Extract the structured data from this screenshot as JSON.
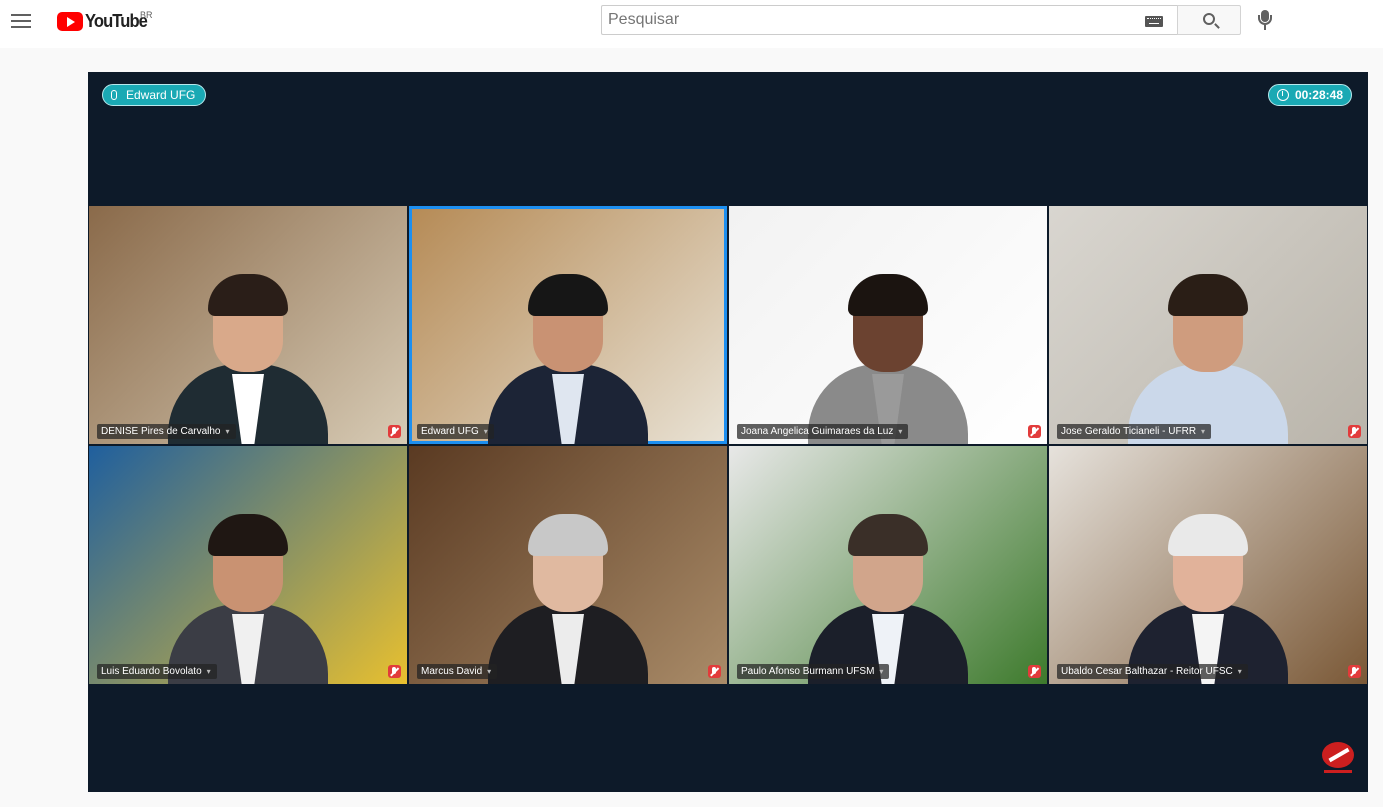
{
  "header": {
    "logo_text": "YouTube",
    "region": "BR",
    "search_placeholder": "Pesquisar"
  },
  "call": {
    "active_speaker": "Edward UFG",
    "elapsed": "00:28:48"
  },
  "participants": [
    {
      "name": "DENISE Pires de Carvalho",
      "muted": true,
      "background": "bookshelf",
      "bg": "#8a6a4a",
      "bg2": "#d7cbb5",
      "skin": "#d9a98a",
      "hair": "#2a1e18",
      "outfit": "#1f2c33",
      "shirt": "#ffffff"
    },
    {
      "name": "Edward UFG",
      "muted": false,
      "background": "office wall",
      "bg": "#b58a55",
      "bg2": "#e9e3d6",
      "skin": "#c99273",
      "hair": "#161616",
      "outfit": "#1c2436",
      "shirt": "#dfe6f0"
    },
    {
      "name": "Joana Angelica Guimaraes da Luz",
      "muted": true,
      "background": "white wall",
      "bg": "#f2f2f2",
      "bg2": "#ffffff",
      "skin": "#6b4230",
      "hair": "#1b1410",
      "outfit": "#8a8a8a",
      "shirt": "#9a9a9a"
    },
    {
      "name": "Jose Geraldo Ticianeli - UFRR",
      "muted": true,
      "background": "office with flag",
      "bg": "#d9d6d0",
      "bg2": "#b9b4aa",
      "skin": "#cf9c7e",
      "hair": "#2a1e16",
      "outfit": "#cbd8ea",
      "shirt": "#cbd8ea"
    },
    {
      "name": "Luis Eduardo Bovolato",
      "muted": true,
      "background": "UFT logo",
      "bg": "#1f5f9e",
      "bg2": "#e8c02f",
      "skin": "#c99272",
      "hair": "#1f1713",
      "outfit": "#3b3d45",
      "shirt": "#f0f0f0"
    },
    {
      "name": "Marcus David",
      "muted": true,
      "background": "bookshelf",
      "bg": "#5a3a22",
      "bg2": "#a98b68",
      "skin": "#e0b9a0",
      "hair": "#c8c8c8",
      "outfit": "#1e1e22",
      "shirt": "#ececec"
    },
    {
      "name": "Paulo Afonso Burmann UFSM",
      "muted": true,
      "background": "flags",
      "bg": "#e8e8e8",
      "bg2": "#3d7a2c",
      "skin": "#d1a58b",
      "hair": "#3a2f28",
      "outfit": "#1b1f2a",
      "shirt": "#eef2f7"
    },
    {
      "name": "Ubaldo Cesar Balthazar - Reitor UFSC",
      "muted": true,
      "background": "bookshelf",
      "bg": "#e6e2dc",
      "bg2": "#7a5836",
      "skin": "#e1b29a",
      "hair": "#e9e9e9",
      "outfit": "#1e2230",
      "shirt": "#f4f4f4"
    }
  ],
  "colors": {
    "pill": "#1aa9b4",
    "active_border": "#1d8ff0",
    "muted": "#e23b3b",
    "video_bg": "#0d1a29"
  },
  "icons": [
    "menu-icon",
    "youtube-play-icon",
    "keyboard-icon",
    "search-icon",
    "mic-icon",
    "speaker-mic-icon",
    "clock-icon",
    "muted-mic-icon",
    "broadcaster-logo-icon"
  ]
}
